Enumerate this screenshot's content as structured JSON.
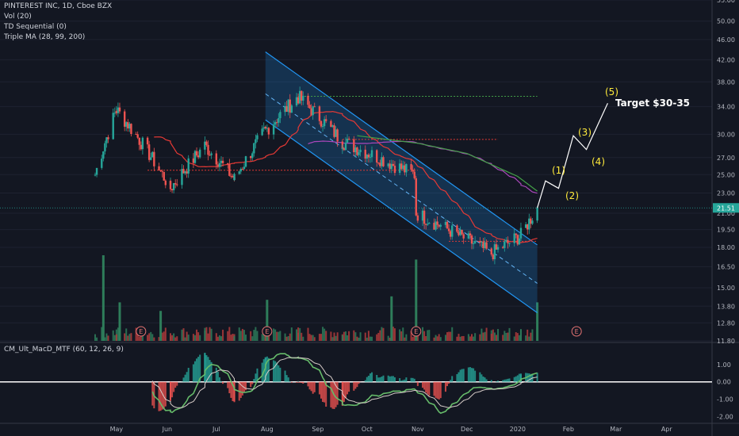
{
  "legend": {
    "symbol": "PINTEREST INC, 1D, Cboe BZX",
    "vol": "Vol (20)",
    "td": "TD Sequential (0)",
    "ma": "Triple MA (28, 99, 200)"
  },
  "oscillator_title": "CM_Ult_MacD_MTF (60, 12, 26, 9)",
  "annotations": {
    "w1": "(1)",
    "w2": "(2)",
    "w3": "(3)",
    "w4": "(4)",
    "w5": "(5)",
    "target": "Target $30-35",
    "earnings": "E"
  },
  "current_price": "21.51",
  "colors": {
    "background": "#131722",
    "up": "#26a69a",
    "down": "#ef5350",
    "channel": "#2196f3",
    "wave": "#ffeb3b",
    "price_badge": "#26a69a"
  },
  "chart_data": {
    "type": "candlestick",
    "ylim": [
      11.8,
      55.0
    ],
    "y_scale": "log",
    "price_ticks": [
      55.0,
      50.0,
      46.0,
      42.0,
      38.0,
      34.0,
      30.0,
      27.0,
      25.0,
      23.0,
      21.0,
      19.5,
      18.0,
      16.5,
      15.0,
      13.8,
      12.8,
      11.8
    ],
    "months": [
      "May",
      "Jun",
      "Jul",
      "Aug",
      "Sep",
      "Oct",
      "Nov",
      "Dec",
      "2020",
      "Feb",
      "Mar",
      "Apr"
    ],
    "x_range": [
      "2019-04-18",
      "2020-04-20"
    ],
    "current_price": 21.51,
    "segments": [
      {
        "from": "2019-04-18",
        "to": "2019-05-01",
        "start": 25.0,
        "end": 33.5
      },
      {
        "from": "2019-05-01",
        "to": "2019-06-03",
        "start": 33.5,
        "end": 23.5
      },
      {
        "from": "2019-06-03",
        "to": "2019-06-24",
        "start": 23.5,
        "end": 28.5
      },
      {
        "from": "2019-06-24",
        "to": "2019-07-12",
        "start": 28.5,
        "end": 24.5
      },
      {
        "from": "2019-07-12",
        "to": "2019-07-31",
        "start": 24.5,
        "end": 30.5
      },
      {
        "from": "2019-07-31",
        "to": "2019-08-20",
        "start": 30.5,
        "end": 35.5
      },
      {
        "from": "2019-08-20",
        "to": "2019-09-16",
        "start": 35.5,
        "end": 29.0
      },
      {
        "from": "2019-09-16",
        "to": "2019-10-30",
        "start": 29.0,
        "end": 25.0
      },
      {
        "from": "2019-10-31",
        "to": "2019-12-16",
        "start": 21.0,
        "end": 17.5
      },
      {
        "from": "2019-12-16",
        "to": "2020-01-03",
        "start": 17.5,
        "end": 19.0
      },
      {
        "from": "2020-01-03",
        "to": "2020-01-13",
        "start": 19.0,
        "end": 21.5
      }
    ],
    "channel": {
      "upper": [
        {
          "date": "2019-07-31",
          "price": 43.5
        },
        {
          "date": "2020-01-13",
          "price": 18.2
        }
      ],
      "mid": [
        {
          "date": "2019-07-31",
          "price": 36.0
        },
        {
          "date": "2020-01-13",
          "price": 15.3
        }
      ],
      "lower": [
        {
          "date": "2019-07-31",
          "price": 32.0
        },
        {
          "date": "2020-01-13",
          "price": 13.4
        }
      ]
    },
    "levels": [
      {
        "price": 35.6,
        "from": "2019-08-20",
        "to": "2020-01-13",
        "color": "#43a047"
      },
      {
        "price": 29.3,
        "from": "2019-09-16",
        "to": "2019-12-20",
        "color": "#e53935"
      },
      {
        "price": 25.5,
        "from": "2019-05-20",
        "to": "2019-11-01",
        "color": "#e53935"
      },
      {
        "price": 18.5,
        "from": "2019-11-20",
        "to": "2020-01-13",
        "color": "#e53935"
      }
    ],
    "ma200": [
      {
        "date": "2019-09-25",
        "price": 29.8
      },
      {
        "date": "2019-11-01",
        "price": 28.8
      },
      {
        "date": "2019-12-01",
        "price": 27.5
      },
      {
        "date": "2020-01-01",
        "price": 24.8
      },
      {
        "date": "2020-01-13",
        "price": 23.2
      }
    ],
    "wave_path": [
      {
        "date": "2020-01-13",
        "price": 21.51
      },
      {
        "date": "2020-01-18",
        "price": 24.3
      },
      {
        "date": "2020-01-26",
        "price": 23.5
      },
      {
        "date": "2020-02-04",
        "price": 29.8
      },
      {
        "date": "2020-02-12",
        "price": 28.0
      },
      {
        "date": "2020-02-25",
        "price": 34.5
      }
    ],
    "earnings_dates": [
      "2019-05-16",
      "2019-08-01",
      "2019-10-31",
      "2020-02-06"
    ],
    "volume_spikes": [
      {
        "date": "2019-04-23",
        "value": 100
      },
      {
        "date": "2019-05-03",
        "value": 45
      },
      {
        "date": "2019-05-28",
        "value": 35
      },
      {
        "date": "2019-08-01",
        "value": 48
      },
      {
        "date": "2019-10-16",
        "value": 52
      },
      {
        "date": "2019-10-31",
        "value": 95
      },
      {
        "date": "2020-01-13",
        "value": 45
      }
    ],
    "oscillator": {
      "ylim": [
        -2.3,
        2.0
      ],
      "ticks": [
        1.0,
        0.0,
        -1.0,
        -2.0
      ],
      "tick_labels": [
        "1.00",
        "0.00",
        "-1.00",
        "-2.00"
      ],
      "zero": 0.0
    }
  }
}
